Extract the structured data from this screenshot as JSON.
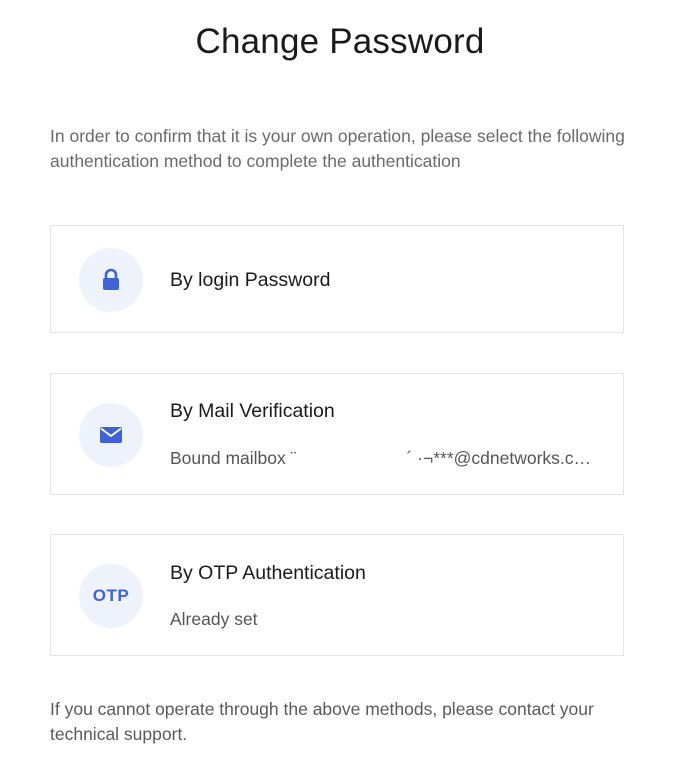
{
  "dialog": {
    "title": "Change Password",
    "intro": "In order to confirm that it is your own operation, please select the following authentication method to complete the authentication",
    "footer_note": "If you cannot operate through the above methods, please contact your technical support."
  },
  "methods": [
    {
      "title": "By login Password",
      "icon": "lock-icon"
    },
    {
      "title": "By Mail Verification",
      "icon": "mail-icon",
      "subtitle_prefix": "Bound mailbox",
      "subtitle_value": "¨",
      "subtitle_tail": "´ ·¬***@cdnetworks.c…"
    },
    {
      "title": "By OTP Authentication",
      "icon": "otp-icon",
      "icon_label": "OTP",
      "subtitle": "Already set"
    }
  ],
  "colors": {
    "accent": "#3d63d6",
    "icon_bg": "#eef2fb",
    "card_border": "#e3e5ea"
  }
}
